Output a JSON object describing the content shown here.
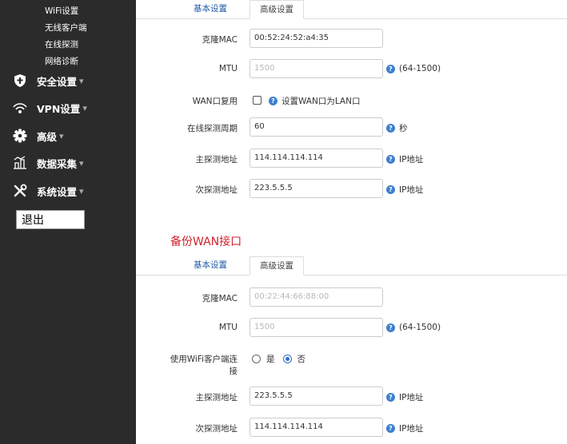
{
  "sidebar": {
    "subitems": [
      "WiFi设置",
      "无线客户端",
      "在线探测",
      "网络诊断"
    ],
    "menus": [
      {
        "icon": "shield-icon",
        "label": "安全设置",
        "caret": "▾"
      },
      {
        "icon": "vpn-icon",
        "label": "VPN设置",
        "caret": "▾"
      },
      {
        "icon": "gear-icon",
        "label": "高级",
        "caret": "▾"
      },
      {
        "icon": "data-collect-icon",
        "label": "数据采集",
        "caret": "▾"
      },
      {
        "icon": "tools-icon",
        "label": "系统设置",
        "caret": "▾"
      }
    ],
    "logout": "退出"
  },
  "wan": {
    "tabs": {
      "basic": "基本设置",
      "advanced": "高级设置"
    },
    "clone_mac": {
      "label": "克隆MAC",
      "value": "00:52:24:52:a4:35"
    },
    "mtu": {
      "label": "MTU",
      "placeholder": "1500",
      "hint": "(64-1500)"
    },
    "wan_reuse": {
      "label": "WAN口复用",
      "hint": "设置WAN口为LAN口"
    },
    "probe_period": {
      "label": "在线探测周期",
      "value": "60",
      "hint": "秒"
    },
    "primary_probe": {
      "label": "主探测地址",
      "value": "114.114.114.114",
      "hint": "IP地址"
    },
    "secondary_probe": {
      "label": "次探测地址",
      "value": "223.5.5.5",
      "hint": "IP地址"
    }
  },
  "backup": {
    "title": "备份WAN接口",
    "tabs": {
      "basic": "基本设置",
      "advanced": "高级设置"
    },
    "clone_mac": {
      "label": "克隆MAC",
      "placeholder": "00:22:44:66:88:00"
    },
    "mtu": {
      "label": "MTU",
      "placeholder": "1500",
      "hint": "(64-1500)"
    },
    "wifi_client": {
      "label_line1": "使用WiFi客户端连",
      "label_line2": "接",
      "yes": "是",
      "no": "否"
    },
    "primary_probe": {
      "label": "主探测地址",
      "value": "223.5.5.5",
      "hint": "IP地址"
    },
    "secondary_probe": {
      "label": "次探测地址",
      "value": "114.114.114.114",
      "hint": "IP地址"
    }
  }
}
